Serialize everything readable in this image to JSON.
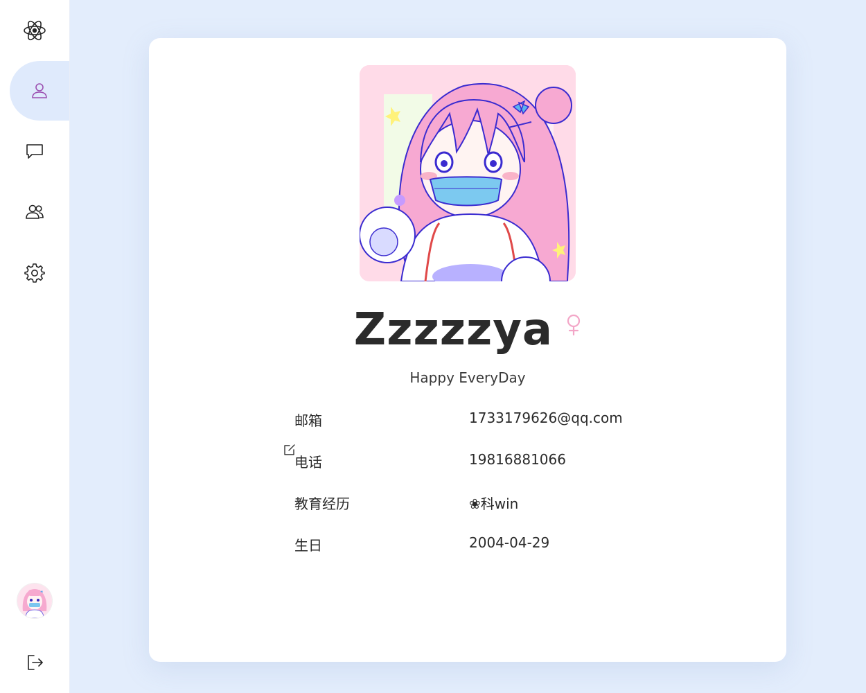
{
  "sidebar": {
    "logo_icon": "atom-logo-icon",
    "items": [
      {
        "name": "profile",
        "icon": "user-icon",
        "active": true
      },
      {
        "name": "messages",
        "icon": "chat-bubble-icon",
        "active": false
      },
      {
        "name": "contacts",
        "icon": "users-icon",
        "active": false
      },
      {
        "name": "settings",
        "icon": "gear-icon",
        "active": false
      }
    ],
    "logout_icon": "logout-icon"
  },
  "profile": {
    "name": "Zzzzzya",
    "gender_icon": "female-icon",
    "motto": "Happy EveryDay",
    "fields": [
      {
        "label": "邮箱",
        "value": "1733179626@qq.com"
      },
      {
        "label": "电话",
        "value": "19816881066"
      },
      {
        "label": "教育经历",
        "value": "❀科win"
      },
      {
        "label": "生日",
        "value": "2004-04-29"
      }
    ]
  },
  "colors": {
    "background": "#e3edfc",
    "active_tab": "#dfeafc",
    "accent_purple": "#9b4fb0",
    "female_pink": "#f3a6c7"
  }
}
